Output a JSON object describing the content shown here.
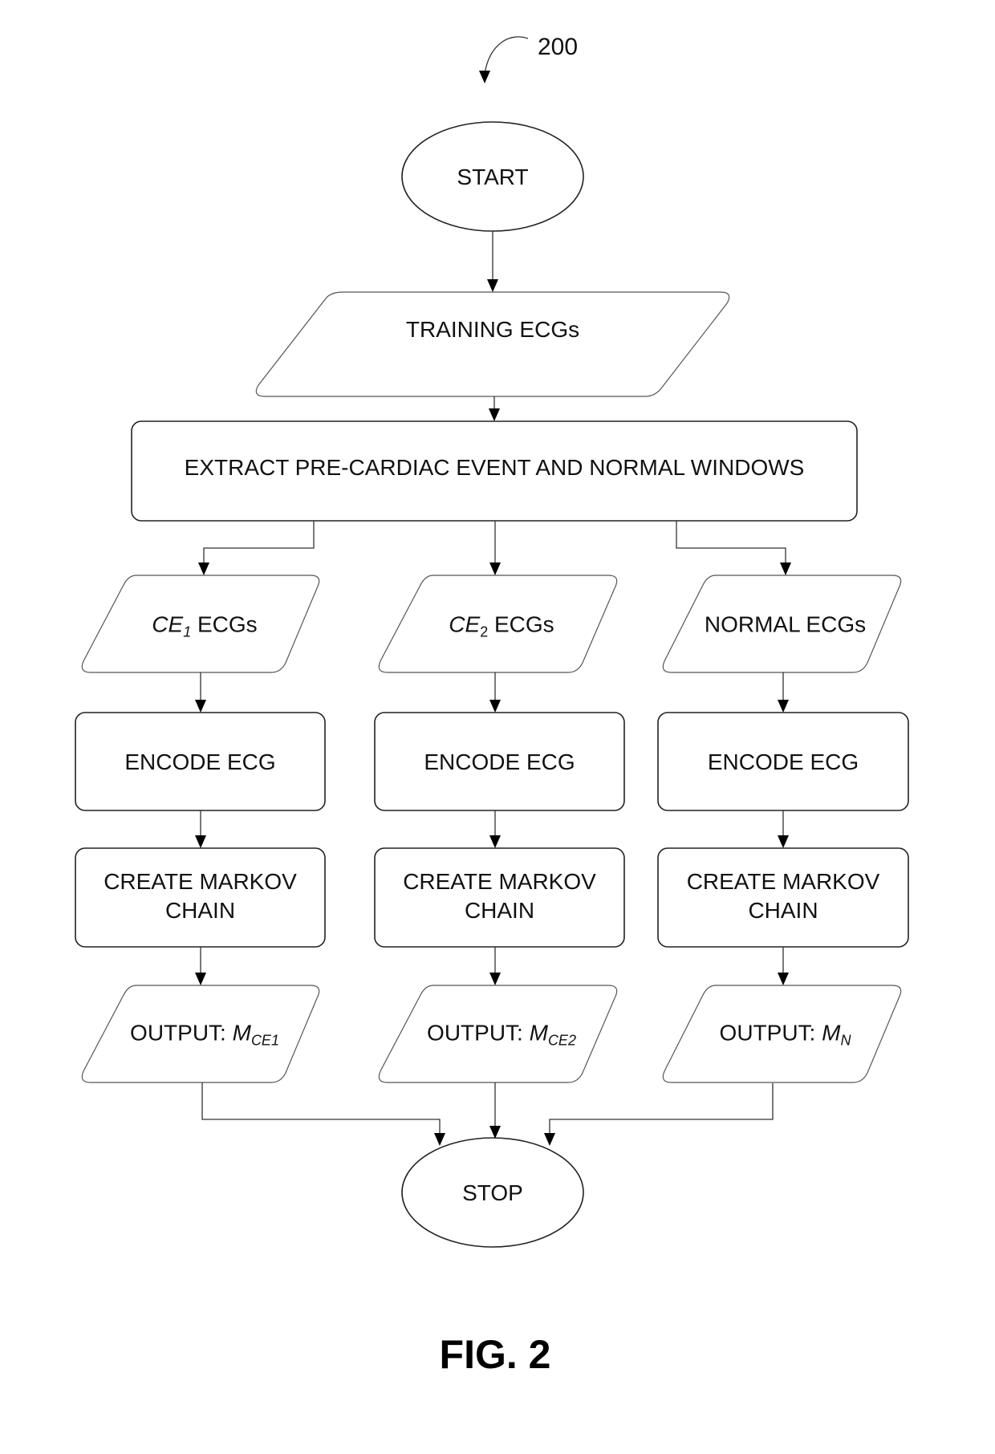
{
  "figure": {
    "reference_numeral": "200",
    "caption": "FIG. 2"
  },
  "nodes": {
    "start": {
      "type": "terminator",
      "label": "START"
    },
    "training": {
      "type": "io",
      "label": "TRAINING ECGs"
    },
    "extract": {
      "type": "process",
      "label": "EXTRACT PRE-CARDIAC EVENT AND NORMAL WINDOWS"
    },
    "columns": [
      {
        "input": {
          "type": "io",
          "label_main": "CE",
          "label_sub": "1",
          "label_suffix": " ECGs",
          "italic_main": true
        },
        "encode": {
          "type": "process",
          "label": "ENCODE ECG"
        },
        "markov": {
          "type": "process",
          "label_line1": "CREATE MARKOV",
          "label_line2": "CHAIN"
        },
        "output": {
          "type": "io",
          "label_prefix": "OUTPUT: ",
          "label_main": "M",
          "label_sub": "CE1"
        }
      },
      {
        "input": {
          "type": "io",
          "label_main": "CE",
          "label_sub": "2",
          "label_suffix": " ECGs",
          "italic_main": true
        },
        "encode": {
          "type": "process",
          "label": "ENCODE ECG"
        },
        "markov": {
          "type": "process",
          "label_line1": "CREATE MARKOV",
          "label_line2": "CHAIN"
        },
        "output": {
          "type": "io",
          "label_prefix": "OUTPUT: ",
          "label_main": "M",
          "label_sub": "CE2"
        }
      },
      {
        "input": {
          "type": "io",
          "label_main": "NORMAL ECGs",
          "label_sub": "",
          "label_suffix": "",
          "italic_main": false
        },
        "encode": {
          "type": "process",
          "label": "ENCODE ECG"
        },
        "markov": {
          "type": "process",
          "label_line1": "CREATE MARKOV",
          "label_line2": "CHAIN"
        },
        "output": {
          "type": "io",
          "label_prefix": "OUTPUT: ",
          "label_main": "M",
          "label_sub": "N"
        }
      }
    ],
    "stop": {
      "type": "terminator",
      "label": "STOP"
    }
  },
  "edges": [
    [
      "start",
      "training"
    ],
    [
      "training",
      "extract"
    ],
    [
      "extract",
      "input-1"
    ],
    [
      "extract",
      "input-2"
    ],
    [
      "extract",
      "input-3"
    ],
    [
      "input-1",
      "encode-1"
    ],
    [
      "input-2",
      "encode-2"
    ],
    [
      "input-3",
      "encode-3"
    ],
    [
      "encode-1",
      "markov-1"
    ],
    [
      "encode-2",
      "markov-2"
    ],
    [
      "encode-3",
      "markov-3"
    ],
    [
      "markov-1",
      "output-1"
    ],
    [
      "markov-2",
      "output-2"
    ],
    [
      "markov-3",
      "output-3"
    ],
    [
      "output-1",
      "stop"
    ],
    [
      "output-2",
      "stop"
    ],
    [
      "output-3",
      "stop"
    ]
  ]
}
